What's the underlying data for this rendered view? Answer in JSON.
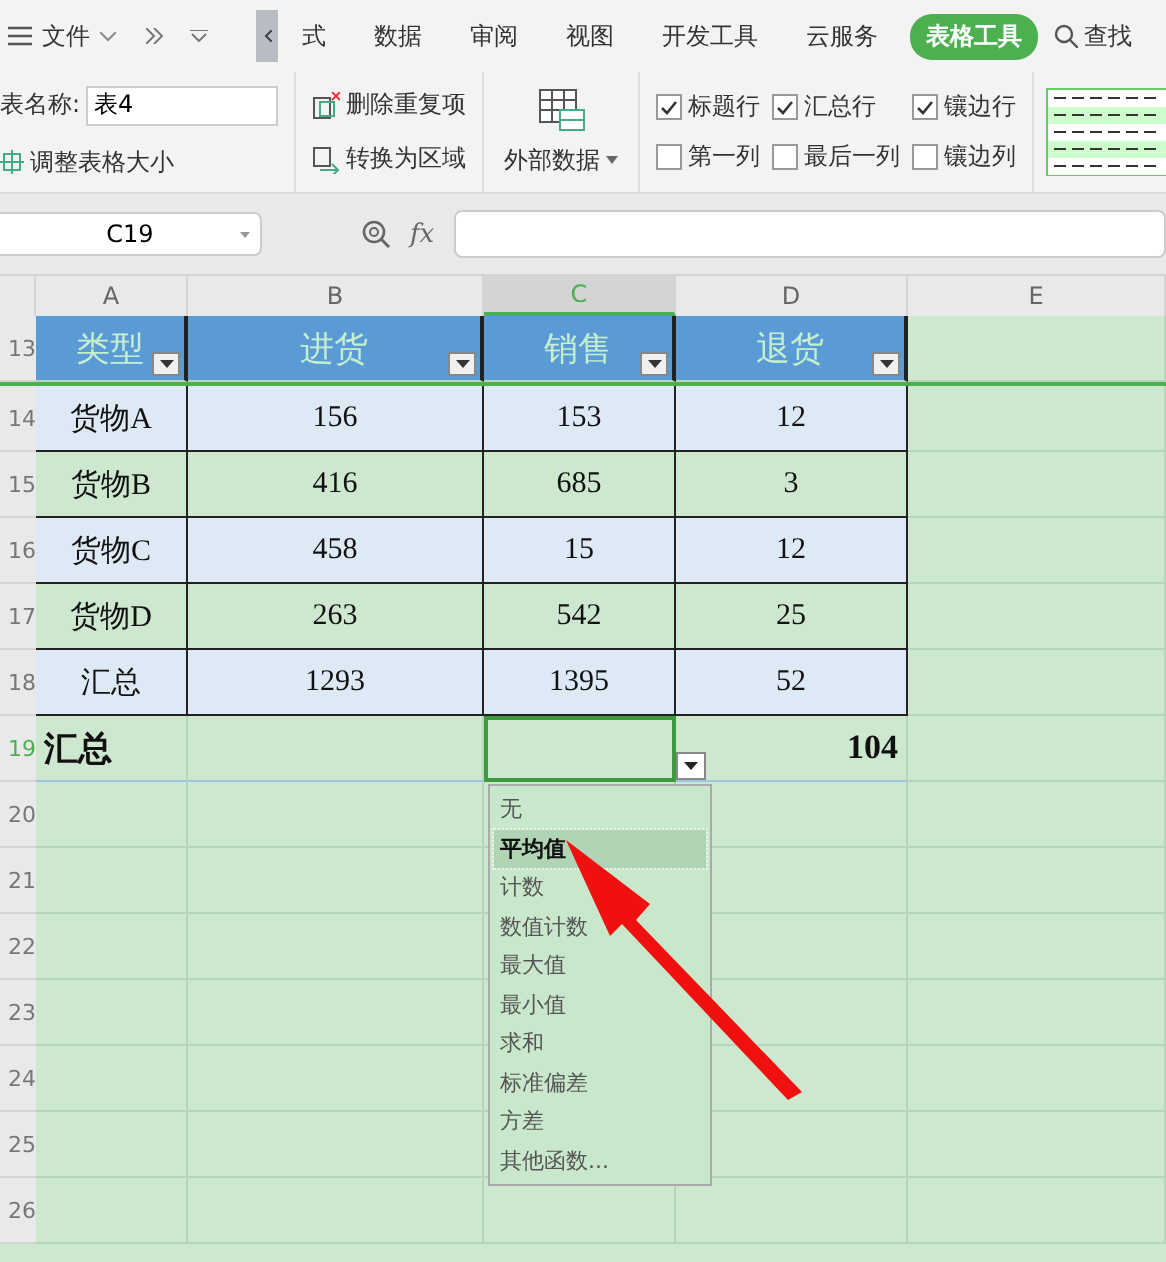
{
  "menu": {
    "file": "文件"
  },
  "tabs": [
    {
      "label": "式",
      "selected": false
    },
    {
      "label": "数据",
      "selected": false
    },
    {
      "label": "审阅",
      "selected": false
    },
    {
      "label": "视图",
      "selected": false
    },
    {
      "label": "开发工具",
      "selected": false
    },
    {
      "label": "云服务",
      "selected": false
    },
    {
      "label": "表格工具",
      "selected": true
    }
  ],
  "search": {
    "label": "查找"
  },
  "ribbon": {
    "table_name_label": "表名称:",
    "table_name": "表4",
    "resize": "调整表格大小",
    "remove_duplicates": "删除重复项",
    "convert_to_range": "转换为区域",
    "external_data": "外部数据",
    "options": [
      {
        "label": "标题行",
        "checked": true
      },
      {
        "label": "汇总行",
        "checked": true
      },
      {
        "label": "镶边行",
        "checked": true
      },
      {
        "label": "第一列",
        "checked": false
      },
      {
        "label": "最后一列",
        "checked": false
      },
      {
        "label": "镶边列",
        "checked": false
      }
    ]
  },
  "formula_bar": {
    "name_box": "C19",
    "fx": "fx"
  },
  "columns": [
    {
      "label": "A",
      "selected": false
    },
    {
      "label": "B",
      "selected": false
    },
    {
      "label": "C",
      "selected": true
    },
    {
      "label": "D",
      "selected": false
    },
    {
      "label": "E",
      "selected": false
    }
  ],
  "table": {
    "header_row": "13",
    "headers": [
      "类型",
      "进货",
      "销售",
      "退货"
    ],
    "rows": [
      {
        "number": "14",
        "cells": [
          "货物A",
          "156",
          "153",
          "12"
        ]
      },
      {
        "number": "15",
        "cells": [
          "货物B",
          "416",
          "685",
          "3"
        ]
      },
      {
        "number": "16",
        "cells": [
          "货物C",
          "458",
          "15",
          "12"
        ]
      },
      {
        "number": "17",
        "cells": [
          "货物D",
          "263",
          "542",
          "25"
        ]
      },
      {
        "number": "18",
        "cells": [
          "汇总",
          "1293",
          "1395",
          "52"
        ]
      }
    ],
    "total_row": {
      "number": "19",
      "label": "汇总",
      "value": "104"
    }
  },
  "empty_rows": [
    "20",
    "21",
    "22",
    "23",
    "24",
    "25",
    "26"
  ],
  "dropdown": {
    "items": [
      {
        "label": "无",
        "selected": false
      },
      {
        "label": "平均值",
        "selected": true
      },
      {
        "label": "计数",
        "selected": false
      },
      {
        "label": "数值计数",
        "selected": false
      },
      {
        "label": "最大值",
        "selected": false
      },
      {
        "label": "最小值",
        "selected": false
      },
      {
        "label": "求和",
        "selected": false
      },
      {
        "label": "标准偏差",
        "selected": false
      },
      {
        "label": "方差",
        "selected": false
      },
      {
        "label": "其他函数...",
        "selected": false
      }
    ]
  }
}
